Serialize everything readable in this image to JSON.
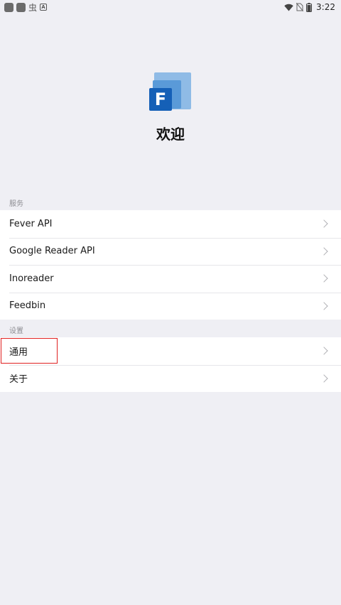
{
  "status_bar": {
    "time": "3:22",
    "icons": [
      "app-icon",
      "app-icon",
      "bug-icon",
      "accessibility-icon",
      "wifi-icon",
      "no-sim-icon",
      "battery-icon"
    ]
  },
  "header": {
    "logo_letter": "F",
    "welcome": "欢迎"
  },
  "services": {
    "label": "服务",
    "items": [
      {
        "label": "Fever API"
      },
      {
        "label": "Google Reader API"
      },
      {
        "label": "Inoreader"
      },
      {
        "label": "Feedbin"
      }
    ]
  },
  "settings": {
    "label": "设置",
    "items": [
      {
        "label": "通用"
      },
      {
        "label": "关于"
      }
    ]
  },
  "colors": {
    "background": "#efeff4",
    "logo_blue": "#1560b7",
    "highlight": "#e02020"
  }
}
